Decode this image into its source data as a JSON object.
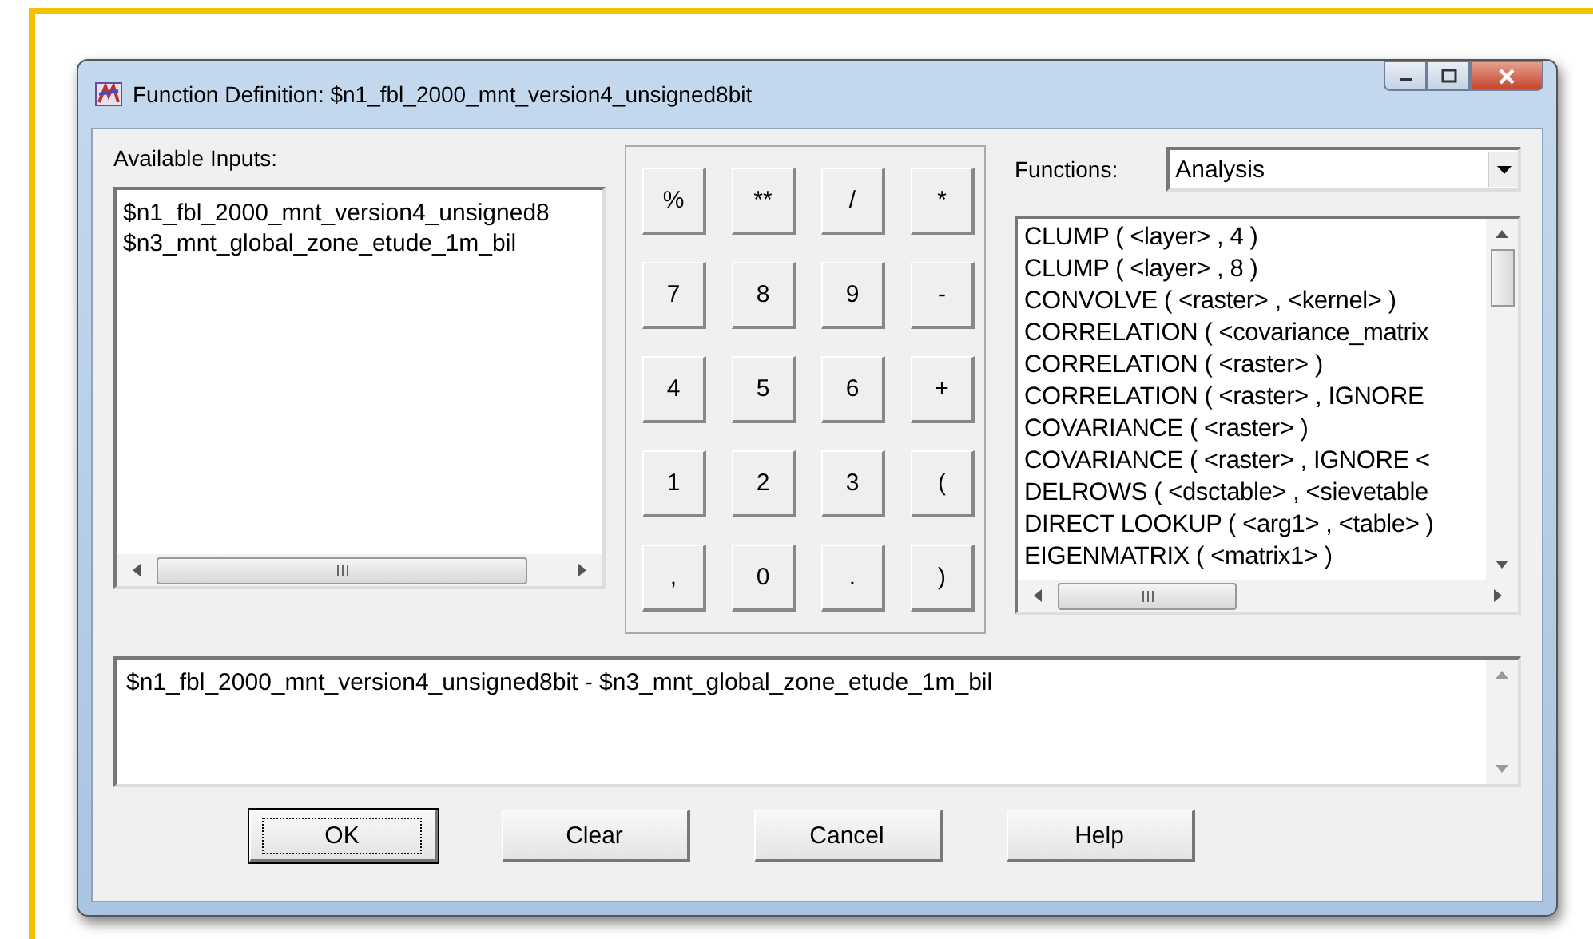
{
  "window": {
    "title": "Function Definition:  $n1_fbl_2000_mnt_version4_unsigned8bit"
  },
  "inputs": {
    "label": "Available Inputs:",
    "items": [
      "$n1_fbl_2000_mnt_version4_unsigned8",
      "$n3_mnt_global_zone_etude_1m_bil"
    ]
  },
  "keypad": [
    "%",
    "**",
    "/",
    "*",
    "7",
    "8",
    "9",
    "-",
    "4",
    "5",
    "6",
    "+",
    "1",
    "2",
    "3",
    "(",
    ",",
    "0",
    ".",
    ")"
  ],
  "functions": {
    "label": "Functions:",
    "category": "Analysis",
    "items": [
      "CLUMP ( <layer> , 4 )",
      "CLUMP ( <layer> , 8 )",
      "CONVOLVE ( <raster> , <kernel> )",
      "CORRELATION ( <covariance_matrix",
      "CORRELATION ( <raster> )",
      "CORRELATION ( <raster> , IGNORE",
      "COVARIANCE ( <raster> )",
      "COVARIANCE ( <raster> , IGNORE <",
      "DELROWS ( <dsctable> , <sievetable",
      "DIRECT LOOKUP ( <arg1> , <table> )",
      "EIGENMATRIX ( <matrix1> )"
    ]
  },
  "expression": "$n1_fbl_2000_mnt_version4_unsigned8bit - $n3_mnt_global_zone_etude_1m_bil",
  "buttons": [
    {
      "label": "OK",
      "focused": true
    },
    {
      "label": "Clear",
      "focused": false
    },
    {
      "label": "Cancel",
      "focused": false
    },
    {
      "label": "Help",
      "focused": false
    }
  ]
}
